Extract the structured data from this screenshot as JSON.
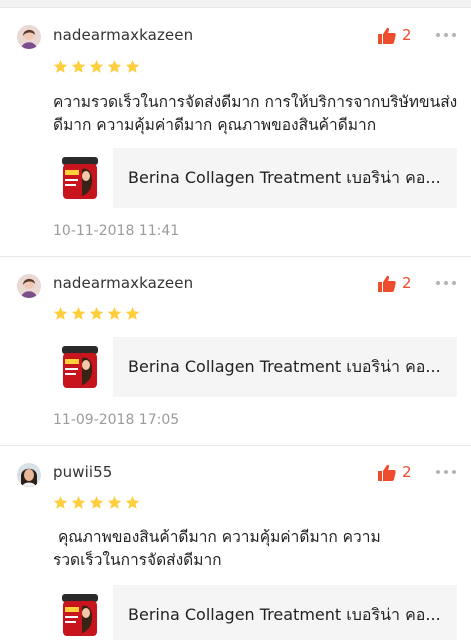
{
  "reviews": [
    {
      "username": "nadearmaxkazeen",
      "likes": "2",
      "rating": 5,
      "comment": "ความรวดเร็วในการจัดส่งดีมาก การให้บริการจากบริษัทขนส่งดีมาก ความคุ้มค่าดีมาก คุณภาพของสินค้าดีมาก",
      "product_name": "Berina Collagen Treatment เบอริน่า คอ...",
      "date": "10-11-2018 11:41"
    },
    {
      "username": "nadearmaxkazeen",
      "likes": "2",
      "rating": 5,
      "comment": "",
      "product_name": "Berina Collagen Treatment เบอริน่า คอ...",
      "date": "11-09-2018 17:05"
    },
    {
      "username": "puwii55",
      "likes": "2",
      "rating": 5,
      "comment": " คุณภาพของสินค้าดีมาก ความคุ้มค่าดีมาก ความรวดเร็วในการจัดส่งดีมาก",
      "product_name": "Berina Collagen Treatment เบอริน่า คอ...",
      "date": ""
    }
  ],
  "icons": {
    "like": "thumbs-up-icon",
    "more": "more-dots-icon",
    "star": "star-icon"
  },
  "colors": {
    "accent": "#ee4d2d",
    "star": "#ffce3d",
    "muted": "#9b9b9b"
  }
}
